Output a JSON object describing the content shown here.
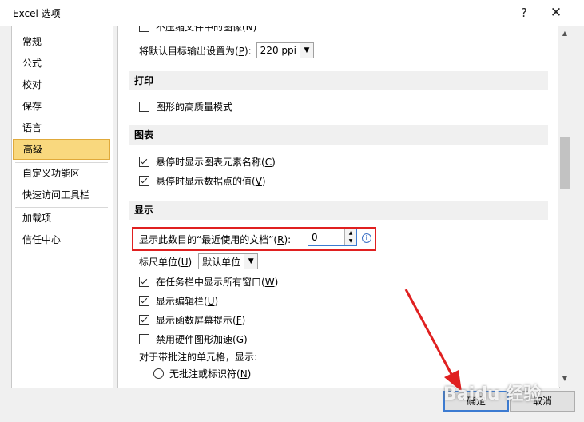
{
  "window": {
    "title": "Excel 选项",
    "help_label": "?",
    "close_label": "✕"
  },
  "sidebar": {
    "items": [
      {
        "label": "常规"
      },
      {
        "label": "公式"
      },
      {
        "label": "校对"
      },
      {
        "label": "保存"
      },
      {
        "label": "语言"
      },
      {
        "label": "高级"
      },
      {
        "label": "自定义功能区"
      },
      {
        "label": "快速访问工具栏"
      },
      {
        "label": "加载项"
      },
      {
        "label": "信任中心"
      }
    ],
    "active": "高级"
  },
  "content": {
    "partial_top_row": "不压缩文件中的图像(N)",
    "default_target": {
      "label": "将默认目标输出设置为(",
      "key": "P",
      "suffix": "):",
      "value": "220 ppi"
    },
    "print_section": {
      "title": "打印",
      "items": [
        {
          "label": "图形的高质量模式",
          "checked": false
        }
      ]
    },
    "chart_section": {
      "title": "图表",
      "items": [
        {
          "label": "悬停时显示图表元素名称(",
          "key": "C",
          "suffix": ")",
          "checked": true
        },
        {
          "label": "悬停时显示数据点的值(",
          "key": "V",
          "suffix": ")",
          "checked": true
        }
      ]
    },
    "display_section": {
      "title": "显示",
      "recent_docs": {
        "label": "显示此数目的“最近使用的文档”(",
        "key": "R",
        "suffix": "):",
        "value": "0",
        "info_icon": "i"
      },
      "ruler_units": {
        "label": "标尺单位(",
        "key": "U",
        "suffix": ")",
        "value": "默认单位"
      },
      "items": [
        {
          "label": "在任务栏中显示所有窗口(",
          "key": "W",
          "suffix": ")",
          "checked": true
        },
        {
          "label": "显示编辑栏(",
          "key": "U",
          "suffix": ")",
          "checked": true
        },
        {
          "label": "显示函数屏幕提示(",
          "key": "F",
          "suffix": ")",
          "checked": true
        },
        {
          "label": "禁用硬件图形加速(",
          "key": "G",
          "suffix": ")",
          "checked": false
        }
      ],
      "comments_label": "对于带批注的单元格，显示:",
      "comments_option": {
        "label": "无批注或标识符(",
        "key": "N",
        "suffix": ")"
      }
    }
  },
  "buttons": {
    "ok": "确定",
    "cancel": "取消"
  },
  "watermark": "Baidu 经验",
  "colors": {
    "highlight": "#e02020",
    "active_tab": "#f9d87e",
    "focus": "#3c7bd1"
  }
}
